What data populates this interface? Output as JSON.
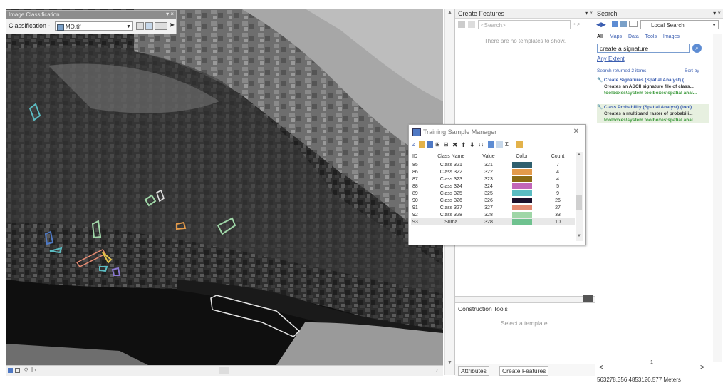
{
  "image_classification": {
    "title": "Image Classification",
    "close": "▾ ×",
    "label": "Classification -",
    "layer": "MO.tif"
  },
  "create_features": {
    "title": "Create Features",
    "header_buttons": "▾ ×",
    "search_placeholder": "<Search>",
    "empty_message": "There are no templates to show.",
    "construction_tools": "Construction Tools",
    "select_template": "Select a template.",
    "tab_attributes": "Attributes",
    "tab_create_features": "Create Features"
  },
  "search_pane": {
    "title": "Search",
    "header_buttons": "▾ ×",
    "mode": "Local Search",
    "tabs": [
      "All",
      "Maps",
      "Data",
      "Tools",
      "Images"
    ],
    "query": "create a signature",
    "extent": "Any Extent",
    "returned": "Search returned 2 items",
    "sort": "Sort by",
    "results": [
      {
        "title": "Create Signatures (Spatial Analyst) (...",
        "desc": "Creates an ASCII signature file of class...",
        "path": "toolboxes\\system toolboxes\\spatial anal..."
      },
      {
        "title": "Class Probability (Spatial Analyst) (tool)",
        "desc": "Creates a multiband raster of probabili...",
        "path": "toolboxes\\system toolboxes\\spatial anal..."
      }
    ],
    "page": "1"
  },
  "coords": "563278.356  4853126.577 Meters",
  "training_sample_manager": {
    "title": "Training Sample Manager",
    "columns": [
      "ID",
      "Class Name",
      "Value",
      "Color",
      "Count"
    ],
    "rows": [
      {
        "id": "85",
        "name": "Class 321",
        "value": "321",
        "color": "#2f5f6e",
        "count": "7"
      },
      {
        "id": "86",
        "name": "Class 322",
        "value": "322",
        "color": "#e39a4a",
        "count": "4"
      },
      {
        "id": "87",
        "name": "Class 323",
        "value": "323",
        "color": "#8a6a14",
        "count": "4"
      },
      {
        "id": "88",
        "name": "Class 324",
        "value": "324",
        "color": "#c266b8",
        "count": "5"
      },
      {
        "id": "89",
        "name": "Class 325",
        "value": "325",
        "color": "#5bbcc2",
        "count": "9"
      },
      {
        "id": "90",
        "name": "Class 326",
        "value": "326",
        "color": "#1c0f2b",
        "count": "26"
      },
      {
        "id": "91",
        "name": "Class 327",
        "value": "327",
        "color": "#e48a72",
        "count": "27"
      },
      {
        "id": "92",
        "name": "Class 328",
        "value": "328",
        "color": "#9fd6a7",
        "count": "33"
      },
      {
        "id": "93",
        "name": "Suma",
        "value": "328",
        "color": "#6fc28f",
        "count": "10"
      }
    ]
  }
}
